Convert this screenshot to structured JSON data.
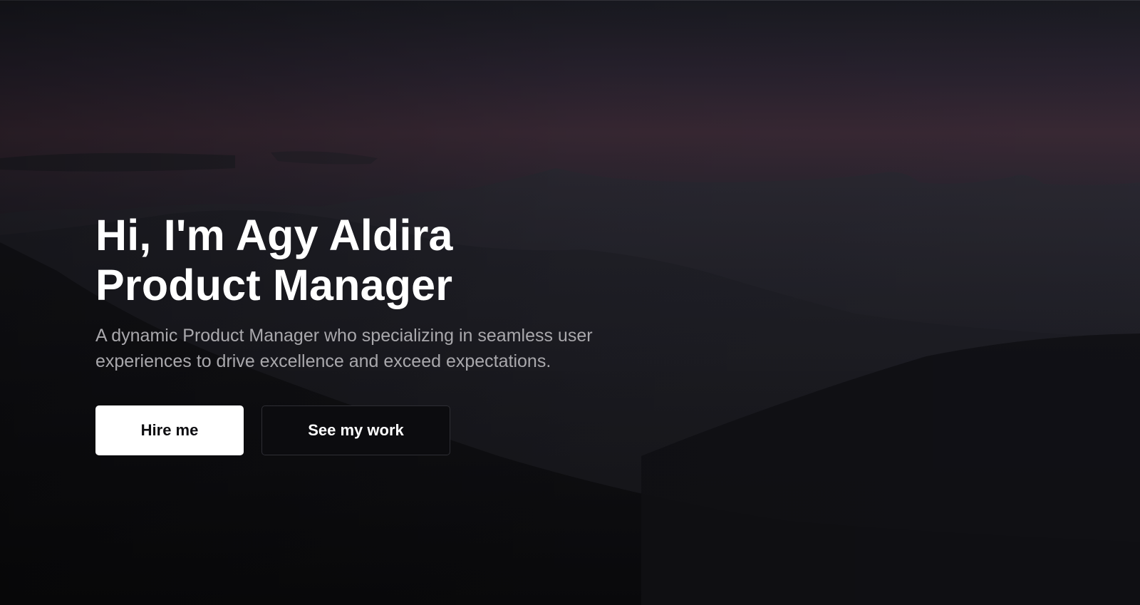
{
  "hero": {
    "headline_line1": "Hi, I'm Agy Aldira",
    "headline_line2": "Product Manager",
    "subtitle": "A dynamic Product Manager who specializing in seamless user experiences to drive excellence and exceed expectations.",
    "primary_button_label": "Hire me",
    "secondary_button_label": "See my work"
  },
  "colors": {
    "background": "#0b0b0d",
    "sky_accent": "#3b2a36",
    "headline": "#ffffff",
    "subtitle": "#a9a8ac",
    "primary_button_bg": "#ffffff",
    "primary_button_text": "#0d0d10",
    "secondary_button_bg": "#0c0c0f",
    "secondary_button_border": "#2e2e34"
  }
}
